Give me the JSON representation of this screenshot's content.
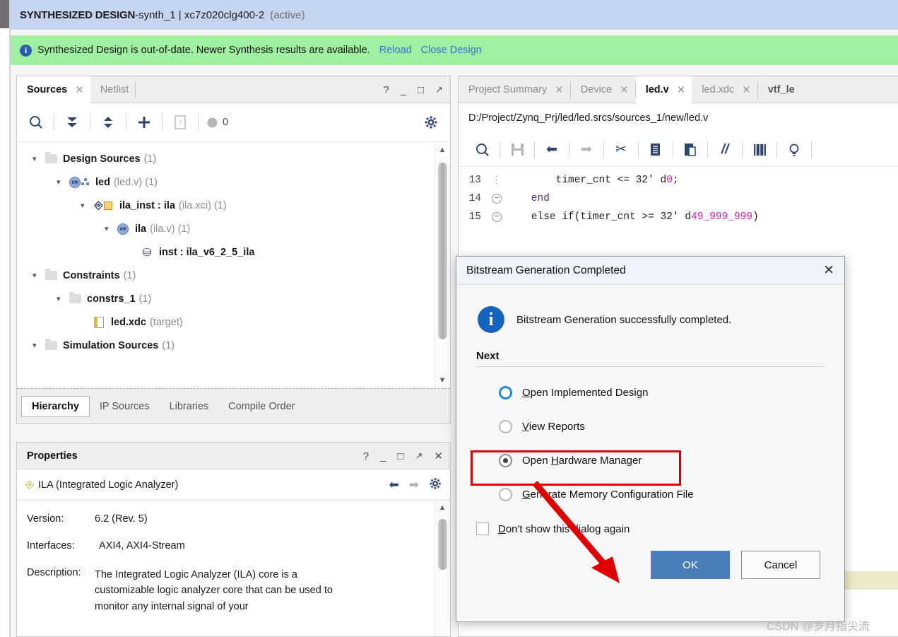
{
  "design_bar": {
    "title": "SYNTHESIZED DESIGN",
    "separator": " - ",
    "run": "synth_1 | xc7z020clg400-2",
    "state": "(active)"
  },
  "banner": {
    "icon": "info-icon",
    "message": "Synthesized Design is out-of-date. Newer Synthesis results are available.",
    "links": [
      "Reload",
      "Close Design"
    ]
  },
  "sources_panel": {
    "tabs": [
      {
        "label": "Sources",
        "active": true,
        "closable": true
      },
      {
        "label": "Netlist",
        "active": false,
        "closable": false
      }
    ],
    "window_buttons": [
      "?",
      "_",
      "□",
      "↗"
    ],
    "toolbar": [
      {
        "name": "search-icon"
      },
      {
        "name": "collapse-all-icon"
      },
      {
        "name": "expand-all-icon"
      },
      {
        "name": "add-sources-icon"
      },
      {
        "name": "report-icon"
      },
      {
        "name": "status-dot-icon"
      }
    ],
    "toolbar_count": "0",
    "settings_icon": "gear-icon",
    "tree": [
      {
        "indent": 0,
        "chevron": "v",
        "icon": "folder-icon",
        "name": "Design Sources",
        "suffix": "(1)"
      },
      {
        "indent": 1,
        "chevron": "v",
        "icon": "verilog-module-icon",
        "name": "led",
        "suffix": "(led.v) (1)"
      },
      {
        "indent": 2,
        "chevron": "v",
        "icon": "ip-core-icon",
        "name": "ila_inst : ila",
        "suffix": "(ila.xci) (1)"
      },
      {
        "indent": 3,
        "chevron": "v",
        "icon": "verilog-file-icon",
        "name": "ila",
        "suffix": "(ila.v) (1)"
      },
      {
        "indent": 4,
        "chevron": "",
        "icon": "ip-instance-icon",
        "name": "inst : ila_v6_2_5_ila",
        "suffix": ""
      },
      {
        "indent": 0,
        "chevron": "v",
        "icon": "folder-icon",
        "name": "Constraints",
        "suffix": "(1)"
      },
      {
        "indent": 1,
        "chevron": "v",
        "icon": "folder-icon",
        "name": "constrs_1",
        "suffix": "(1)"
      },
      {
        "indent": 2,
        "chevron": "",
        "icon": "xdc-file-icon",
        "name": "led.xdc",
        "suffix": "(target)"
      },
      {
        "indent": 0,
        "chevron": "v",
        "icon": "folder-icon",
        "name": "Simulation Sources",
        "suffix": "(1)"
      }
    ],
    "bottom_tabs": [
      {
        "label": "Hierarchy",
        "active": true
      },
      {
        "label": "IP Sources",
        "active": false
      },
      {
        "label": "Libraries",
        "active": false
      },
      {
        "label": "Compile Order",
        "active": false
      }
    ]
  },
  "properties_panel": {
    "title": "Properties",
    "window_buttons": [
      "?",
      "_",
      "□",
      "↗",
      "×"
    ],
    "subject_icon": "ila-pin-icon",
    "subject": "ILA (Integrated Logic Analyzer)",
    "nav_icons": [
      "back-arrow-icon",
      "forward-arrow-icon",
      "gear-icon"
    ],
    "rows": [
      {
        "label": "Version:",
        "value": "6.2 (Rev. 5)"
      },
      {
        "label": "Interfaces:",
        "value": "AXI4, AXI4-Stream"
      },
      {
        "label": "Description:",
        "value": "The Integrated Logic Analyzer (ILA) core is a customizable logic analyzer core that can be used to monitor any internal signal of your"
      }
    ]
  },
  "editor_panel": {
    "tabs": [
      {
        "label": "Project Summary",
        "active": false,
        "closable": true
      },
      {
        "label": "Device",
        "active": false,
        "closable": true
      },
      {
        "label": "led.v",
        "active": true,
        "closable": true
      },
      {
        "label": "led.xdc",
        "active": false,
        "closable": true
      },
      {
        "label": "vtf_le",
        "active": false,
        "closable": false
      }
    ],
    "file_path": "D:/Project/Zynq_Prj/led/led.srcs/sources_1/new/led.v",
    "toolbar": [
      {
        "name": "find-icon"
      },
      {
        "name": "save-icon"
      },
      {
        "name": "undo-icon"
      },
      {
        "name": "redo-icon"
      },
      {
        "name": "cut-icon"
      },
      {
        "name": "copy-icon"
      },
      {
        "name": "paste-icon"
      },
      {
        "name": "comment-icon"
      },
      {
        "name": "indent-icon"
      },
      {
        "name": "hint-icon"
      }
    ],
    "code_lines": [
      {
        "num": "13",
        "fold": "dot",
        "text": "        timer_cnt <= 32' d",
        "highlight": "0",
        "tail": ";"
      },
      {
        "num": "14",
        "fold": "minus",
        "text": "    end",
        "highlight": "",
        "tail": ""
      },
      {
        "num": "15",
        "fold": "minus",
        "text": "    else if(timer_cnt >= 32' d",
        "highlight": "49_999_999",
        "tail": ")"
      }
    ]
  },
  "dialog": {
    "title": "Bitstream Generation Completed",
    "close_icon": "close-icon",
    "info_icon": "info-icon",
    "message": "Bitstream Generation successfully completed.",
    "next_label": "Next",
    "options": [
      {
        "label": "Open Implemented Design",
        "mnemonic": "O",
        "selected": false,
        "focused": true
      },
      {
        "label": "View Reports",
        "mnemonic": "V",
        "selected": false,
        "focused": false
      },
      {
        "label": "Open Hardware Manager",
        "mnemonic": "H",
        "selected": true,
        "focused": false
      },
      {
        "label": "Generate Memory Configuration File",
        "mnemonic": "G",
        "selected": false,
        "focused": false
      }
    ],
    "checkbox": {
      "label": "Don't show this dialog again",
      "mnemonic": "D",
      "checked": false
    },
    "buttons": [
      {
        "label": "OK",
        "primary": true
      },
      {
        "label": "Cancel",
        "primary": false
      }
    ]
  },
  "annotation": {
    "highlight_color": "#e00000",
    "arrow_color": "#e00000"
  },
  "watermark": "CSDN @岁月指尖流"
}
